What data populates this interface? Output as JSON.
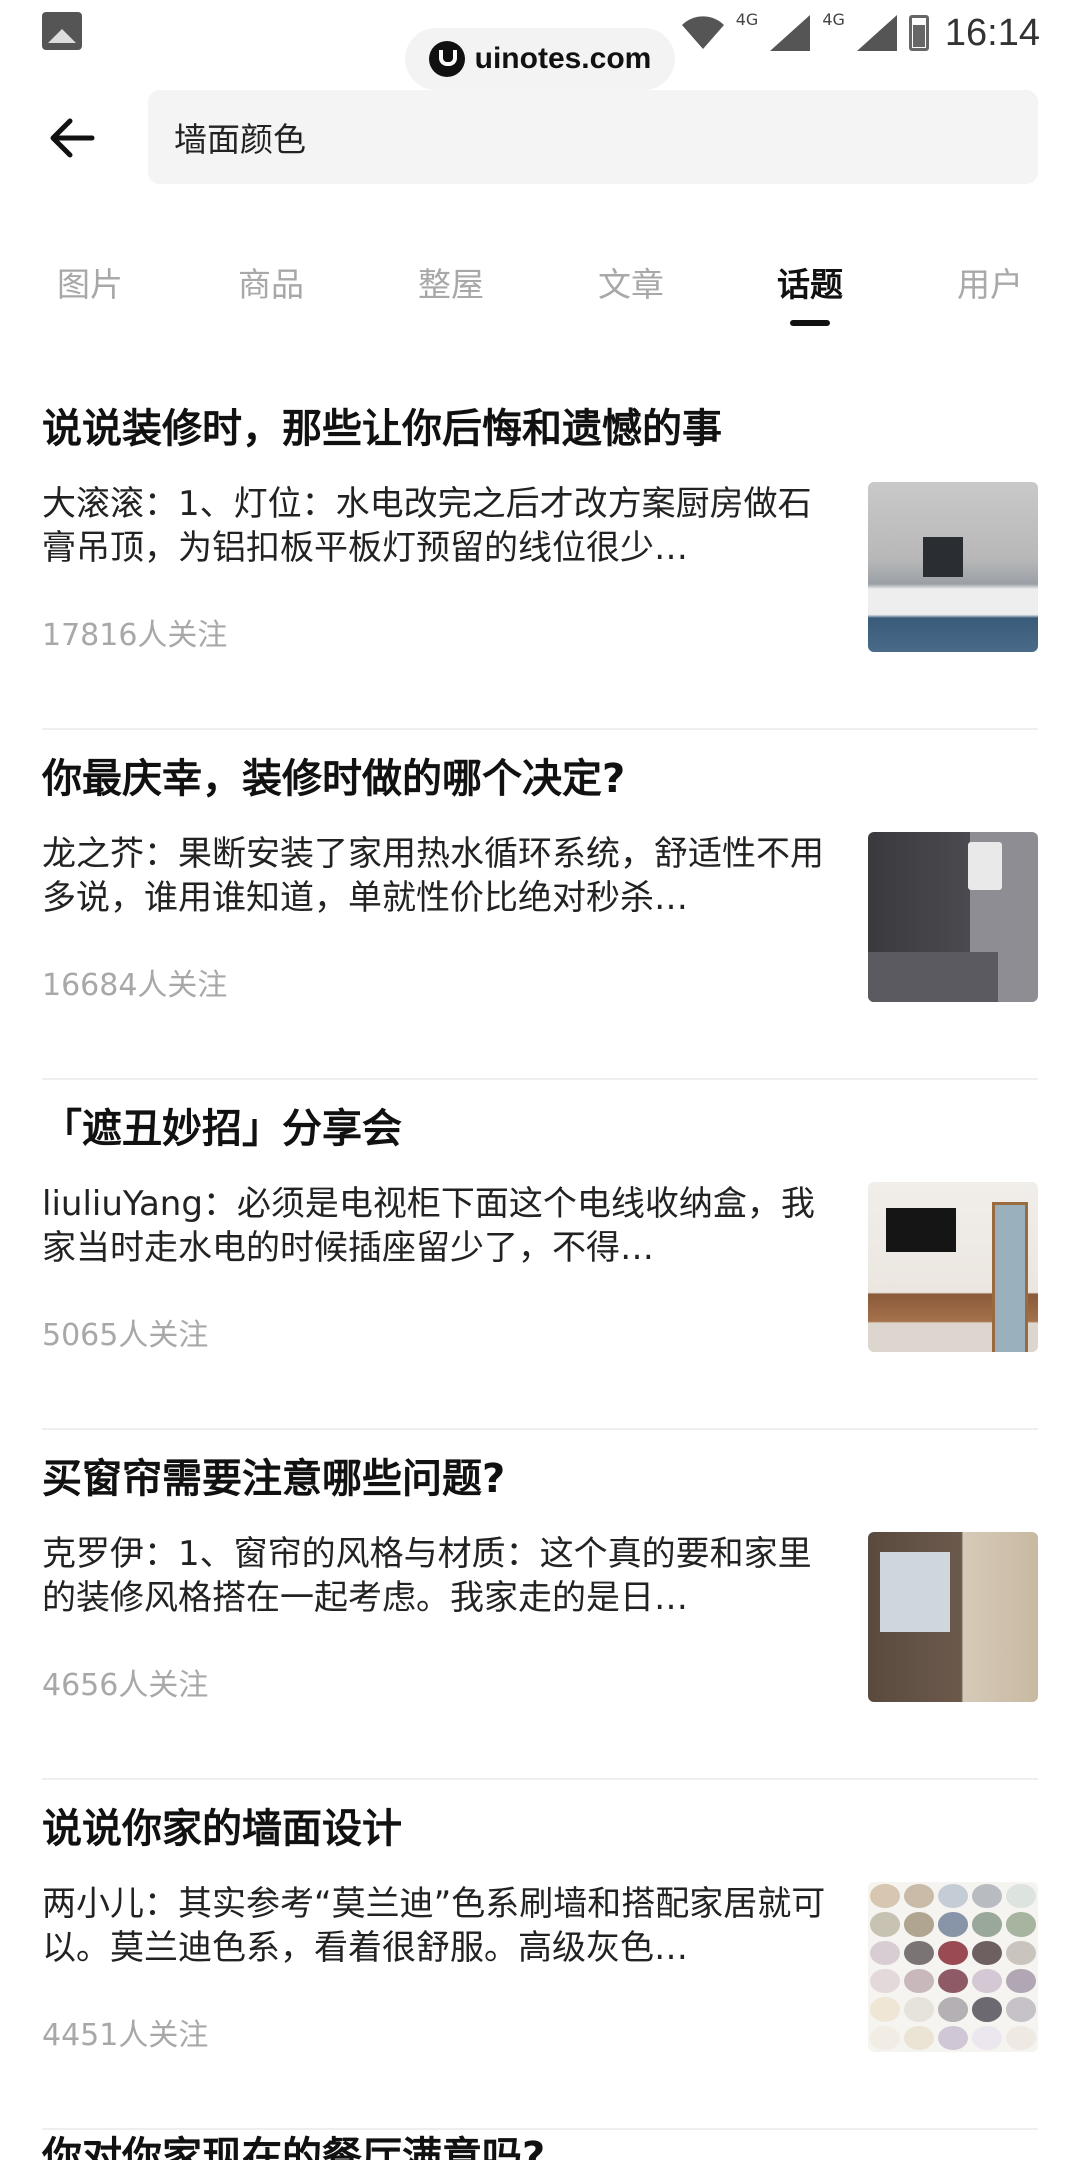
{
  "status_bar": {
    "time": "16:14",
    "network1": "4G",
    "network2": "4G"
  },
  "watermark": {
    "text": "uinotes.com"
  },
  "search": {
    "query": "墙面颜色"
  },
  "tabs": [
    {
      "label": "图片",
      "active": false
    },
    {
      "label": "商品",
      "active": false
    },
    {
      "label": "整屋",
      "active": false
    },
    {
      "label": "文章",
      "active": false
    },
    {
      "label": "话题",
      "active": true
    },
    {
      "label": "用户",
      "active": false
    }
  ],
  "topics": [
    {
      "title": "说说装修时，那些让你后悔和遗憾的事",
      "excerpt": "大滚滚：1、灯位：水电改完之后才改方案厨房做石膏吊顶，为铝扣板平板灯预留的线位很少…",
      "followers": "17816人关注",
      "image": "kitchen-photo"
    },
    {
      "title": "你最庆幸，装修时做的哪个决定?",
      "excerpt": "龙之芥：果断安装了家用热水循环系统，舒适性不用多说，谁用谁知道，单就性价比绝对秒杀…",
      "followers": "16684人关注",
      "image": "water-heater-photo"
    },
    {
      "title": "「遮丑妙招」分享会",
      "excerpt": "liuliuYang：必须是电视柜下面这个电线收纳盒，我家当时走水电的时候插座留少了，不得…",
      "followers": "5065人关注",
      "image": "tv-cabinet-photo"
    },
    {
      "title": "买窗帘需要注意哪些问题?",
      "excerpt": "克罗伊：1、窗帘的风格与材质：这个真的要和家里的装修风格搭在一起考虑。我家走的是日…",
      "followers": "4656人关注",
      "image": "curtain-photo"
    },
    {
      "title": "说说你家的墙面设计",
      "excerpt": "两小儿：其实参考“莫兰迪”色系刷墙和搭配家居就可以。莫兰迪色系，看着很舒服。高级灰色…",
      "followers": "4451人关注",
      "image": "color-swatch-photo"
    }
  ],
  "next_topic": {
    "title": "你对你家现在的餐厅满意吗?"
  },
  "swatch_colors": [
    "#d7c6b0",
    "#c9bba8",
    "#c4ccd6",
    "#b8bcc0",
    "#dde3de",
    "#c7c2b2",
    "#b0a590",
    "#8894a8",
    "#9aa89a",
    "#a7b5a0",
    "#d8cdd2",
    "#7a7474",
    "#9a4a52",
    "#6e6060",
    "#c9c4bd",
    "#e3d8da",
    "#c8b8bc",
    "#8e5a66",
    "#d4c8d4",
    "#b0a6b4",
    "#efe6d6",
    "#e6e2dc",
    "#b4b0b4",
    "#6c6a70",
    "#c6c2c8",
    "#f2ede4",
    "#ebe3d3",
    "#cfc6d6",
    "#ece6ef",
    "#efe9e4"
  ]
}
